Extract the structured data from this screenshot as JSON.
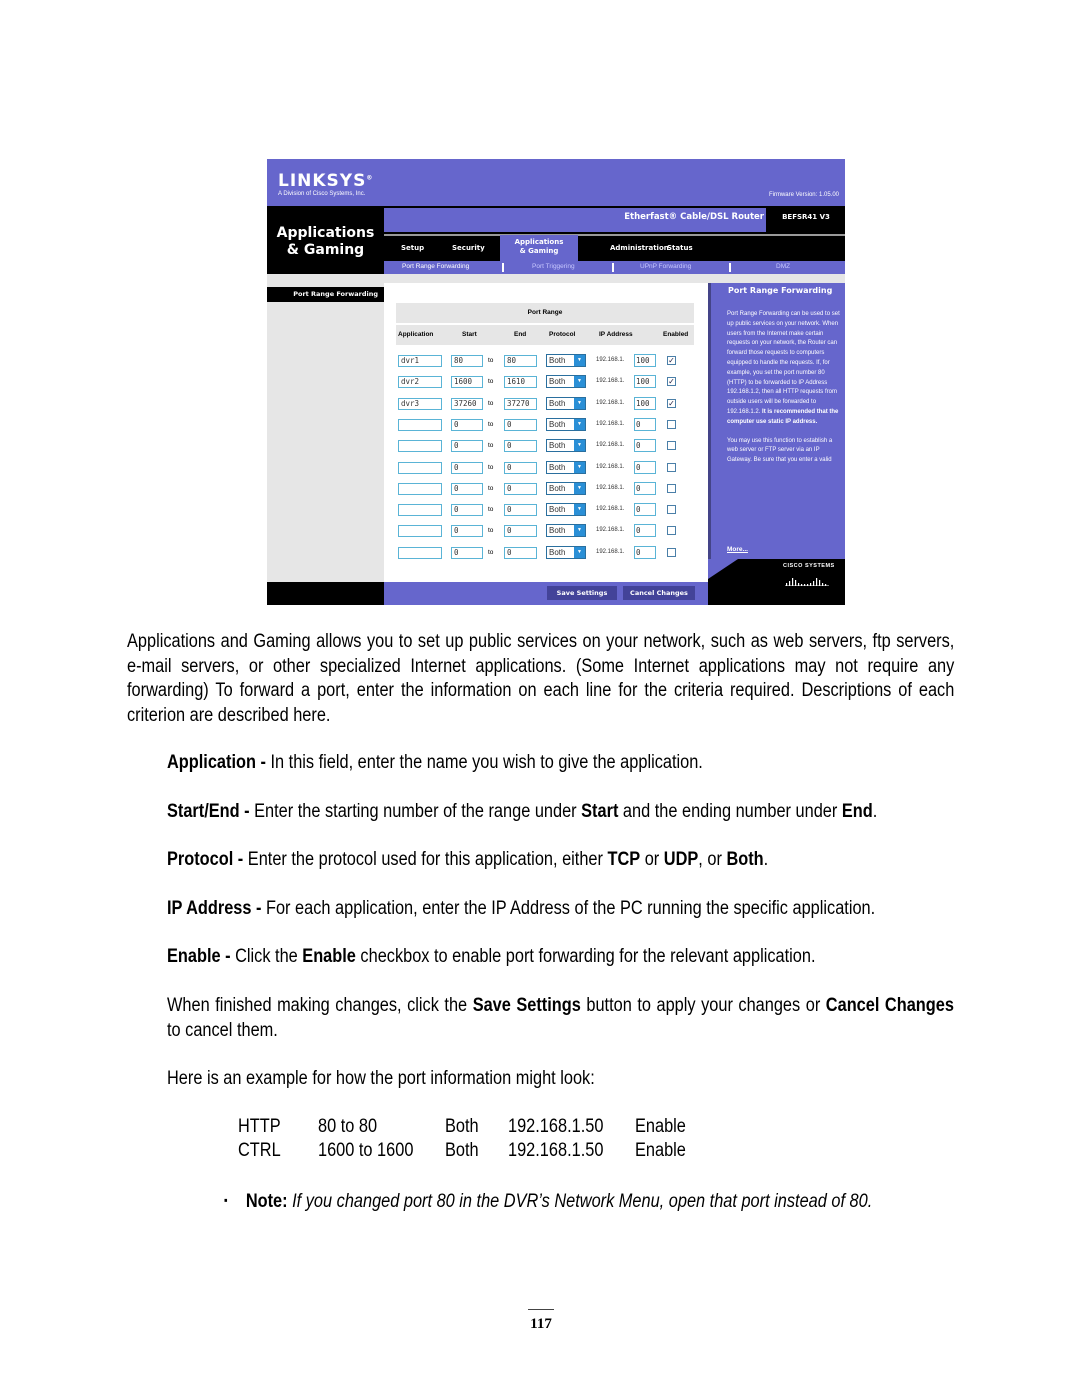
{
  "router_ui": {
    "brand": "LINKSYS",
    "brand_sub": "A Division of Cisco Systems, Inc.",
    "firmware": "Firmware Version: 1.05.00",
    "section_title_line1": "Applications",
    "section_title_line2": "& Gaming",
    "product_name": "Etherfast® Cable/DSL Router",
    "model": "BEFSR41 V3",
    "tabs": [
      {
        "label": "Setup"
      },
      {
        "label": "Security"
      },
      {
        "label": "Applications & Gaming",
        "line1": "Applications",
        "line2": "& Gaming",
        "active": true
      },
      {
        "label": "Administration"
      },
      {
        "label": "Status"
      }
    ],
    "subtabs": [
      {
        "label": "Port Range Forwarding",
        "active": true
      },
      {
        "label": "Port Triggering"
      },
      {
        "label": "UPnP Forwarding"
      },
      {
        "label": "DMZ"
      }
    ],
    "sidebar_heading": "Port Range Forwarding",
    "table": {
      "group_header": "Port Range",
      "columns": [
        "Application",
        "Start",
        "End",
        "Protocol",
        "IP Address",
        "Enabled"
      ],
      "to_label": "to",
      "ip_prefix": "192.168.1.",
      "rows": [
        {
          "application": "dvr1",
          "start": "80",
          "end": "80",
          "protocol": "Both",
          "ip_last": "100",
          "enabled": true
        },
        {
          "application": "dvr2",
          "start": "1600",
          "end": "1610",
          "protocol": "Both",
          "ip_last": "100",
          "enabled": true
        },
        {
          "application": "dvr3",
          "start": "37260",
          "end": "37270",
          "protocol": "Both",
          "ip_last": "100",
          "enabled": true
        },
        {
          "application": "",
          "start": "0",
          "end": "0",
          "protocol": "Both",
          "ip_last": "0",
          "enabled": false
        },
        {
          "application": "",
          "start": "0",
          "end": "0",
          "protocol": "Both",
          "ip_last": "0",
          "enabled": false
        },
        {
          "application": "",
          "start": "0",
          "end": "0",
          "protocol": "Both",
          "ip_last": "0",
          "enabled": false
        },
        {
          "application": "",
          "start": "0",
          "end": "0",
          "protocol": "Both",
          "ip_last": "0",
          "enabled": false
        },
        {
          "application": "",
          "start": "0",
          "end": "0",
          "protocol": "Both",
          "ip_last": "0",
          "enabled": false
        },
        {
          "application": "",
          "start": "0",
          "end": "0",
          "protocol": "Both",
          "ip_last": "0",
          "enabled": false
        },
        {
          "application": "",
          "start": "0",
          "end": "0",
          "protocol": "Both",
          "ip_last": "0",
          "enabled": false
        }
      ]
    },
    "help": {
      "title": "Port Range Forwarding",
      "text_1": "Port Range Forwarding can be used to set up public services on your network. When users from the Internet make certain requests on your network, the Router can forward those requests to computers equipped to handle the requests. If, for example, you set the port number 80 (HTTP) to be forwarded to IP Address 192.168.1.2, then all HTTP requests from outside users will be forwarded to 192.168.1.2.",
      "text_bold": "It is recommended that the computer use static IP address.",
      "text_2": "You may use this function to establish a web server or FTP server via an IP Gateway. Be sure that you enter a valid",
      "more": "More..."
    },
    "cisco_label": "Cisco Systems",
    "save_button": "Save Settings",
    "cancel_button": "Cancel Changes"
  },
  "document": {
    "intro": "Applications and Gaming allows you to set up public services on your network, such as web servers, ftp servers, e-mail servers, or other specialized Internet applications. (Some Internet applications may not require any forwarding) To forward a port, enter the information on each line for the criteria required. Descriptions of each criterion are described here.",
    "criteria": {
      "application_term": "Application -",
      "application_desc": " In this field, enter the name you wish to give the application.",
      "startend_term": "Start/End -",
      "startend_desc_1": " Enter the starting number of the range under ",
      "startend_start": "Start",
      "startend_desc_2": " and the ending number under ",
      "startend_end": "End",
      "startend_desc_3": ".",
      "protocol_term": "Protocol -",
      "protocol_desc_1": " Enter the protocol used for this application, either ",
      "protocol_tcp": "TCP",
      "protocol_or1": " or ",
      "protocol_udp": "UDP",
      "protocol_or2": ", or ",
      "protocol_both": "Both",
      "protocol_end": ".",
      "ip_term": "IP Address -",
      "ip_desc": " For each application, enter the IP Address of the PC running the specific application.",
      "enable_term": "Enable -",
      "enable_desc_1": " Click the ",
      "enable_bold": "Enable",
      "enable_desc_2": " checkbox to enable port forwarding for the relevant application."
    },
    "finish_1": "When finished making changes, click the ",
    "finish_save": "Save Settings",
    "finish_2": " button to apply your changes or ",
    "finish_cancel": "Cancel Changes",
    "finish_3": " to cancel them.",
    "example_intro": "Here is an example for how the port information might look:",
    "example_rows": [
      {
        "name": "HTTP",
        "ports": "80 to 80",
        "protocol": "Both",
        "ip": "192.168.1.50",
        "status": "Enable"
      },
      {
        "name": "CTRL",
        "ports": "1600 to 1600",
        "protocol": "Both",
        "ip": "192.168.1.50",
        "status": "Enable"
      }
    ],
    "note_label": "Note:",
    "note_text": " If you changed port 80 in the DVR’s Network Menu, open that port instead of 80.",
    "page_number": "117"
  }
}
